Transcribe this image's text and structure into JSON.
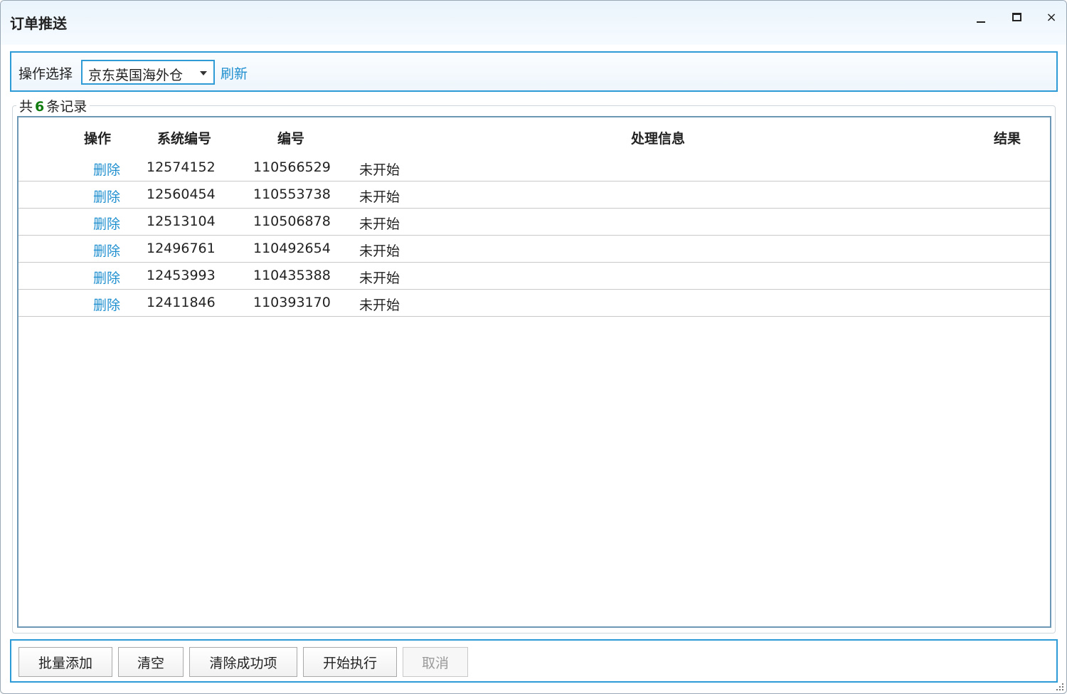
{
  "window": {
    "title": "订单推送",
    "controls": {
      "minimize": "minimize-icon",
      "maximize": "maximize-icon",
      "close": "×"
    }
  },
  "toolbar": {
    "operation_label": "操作选择",
    "operation_selected": "京东英国海外仓",
    "refresh_label": "刷新"
  },
  "records": {
    "prefix": "共",
    "count": "6",
    "suffix": "条记录"
  },
  "table": {
    "columns": [
      "操作",
      "系统编号",
      "编号",
      "处理信息",
      "结果"
    ],
    "rows": [
      {
        "action": "删除",
        "system_id": "12574152",
        "code": "110566529",
        "info": "未开始",
        "result": ""
      },
      {
        "action": "删除",
        "system_id": "12560454",
        "code": "110553738",
        "info": "未开始",
        "result": ""
      },
      {
        "action": "删除",
        "system_id": "12513104",
        "code": "110506878",
        "info": "未开始",
        "result": ""
      },
      {
        "action": "删除",
        "system_id": "12496761",
        "code": "110492654",
        "info": "未开始",
        "result": ""
      },
      {
        "action": "删除",
        "system_id": "12453993",
        "code": "110435388",
        "info": "未开始",
        "result": ""
      },
      {
        "action": "删除",
        "system_id": "12411846",
        "code": "110393170",
        "info": "未开始",
        "result": ""
      }
    ]
  },
  "footer": {
    "batch_add": "批量添加",
    "clear": "清空",
    "clear_success": "清除成功项",
    "start": "开始执行",
    "cancel": "取消"
  },
  "colors": {
    "accent": "#2f9bd6",
    "link": "#1f8fcf",
    "count": "#107c10"
  }
}
